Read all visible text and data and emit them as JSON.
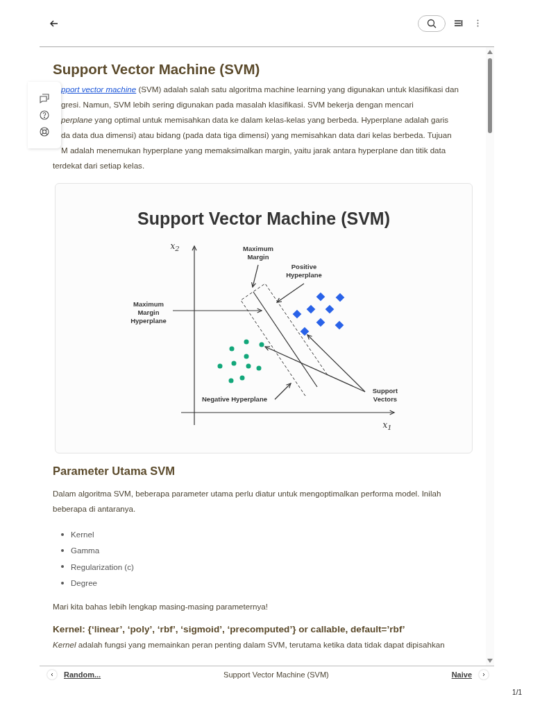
{
  "article": {
    "title": "Support Vector Machine (SVM)",
    "intro": [
      {
        "clipped": true,
        "link": "pport vector machine",
        "text": " (SVM) adalah salah satu algoritma machine learning yang digunakan untuk klasifikasi dan"
      },
      {
        "clipped": true,
        "text": "gresi. Namun, SVM lebih sering digunakan pada masalah klasifikasi. SVM bekerja dengan mencari"
      },
      {
        "clipped": true,
        "text": "*perplane* yang optimal untuk memisahkan data ke dalam kelas-kelas yang berbeda. Hyperplane adalah garis"
      },
      {
        "clipped": true,
        "text": "da data dua dimensi) atau bidang (pada data tiga dimensi) yang memisahkan data dari kelas berbeda. Tujuan"
      },
      {
        "clipped": true,
        "text": "M adalah menemukan hyperplane yang memaksimalkan margin, yaitu jarak antara hyperplane dan titik data"
      },
      {
        "clipped": false,
        "text": "terdekat dari setiap kelas."
      }
    ],
    "figure": {
      "title": "Support Vector Machine (SVM)",
      "labels": [
        {
          "kind": "axis",
          "text": "x$_{2}$"
        },
        {
          "kind": "note",
          "text": "Maximum Margin"
        },
        {
          "kind": "note",
          "text": "Positive Hyperplane"
        },
        {
          "kind": "note",
          "text": "Maximum Margin Hyperplane"
        },
        {
          "kind": "note",
          "text": "Negative Hyperplane"
        },
        {
          "kind": "note",
          "text": "Support Vectors"
        },
        {
          "kind": "axis",
          "text": "x$_{1}$"
        }
      ]
    },
    "sections": [
      {
        "heading": "Parameter Utama SVM",
        "kind": "h2"
      },
      {
        "kind": "p",
        "text": "Dalam algoritma SVM, beberapa parameter utama perlu diatur untuk mengoptimalkan performa model. Inilah beberapa di antaranya."
      },
      {
        "kind": "list",
        "items": [
          "Kernel",
          "Gamma",
          "Regularization (c)",
          "Degree"
        ]
      },
      {
        "kind": "p",
        "text": "Mari kita bahas lebih lengkap masing-masing parameternya!"
      },
      {
        "heading": "Kernel: {‘linear’, ‘poly’, ‘rbf’, ‘sigmoid’, ‘precomputed’} or callable, default=’rbf’",
        "kind": "h3"
      },
      {
        "kind": "p",
        "text": "*Kernel* adalah fungsi yang memainkan peran penting dalam SVM, terutama ketika data tidak dapat dipisahkan"
      }
    ]
  },
  "footer_nav": {
    "previous": "Random...",
    "current": "Support Vector Machine (SVM)",
    "next": "Naive"
  },
  "page_count": "1/1"
}
